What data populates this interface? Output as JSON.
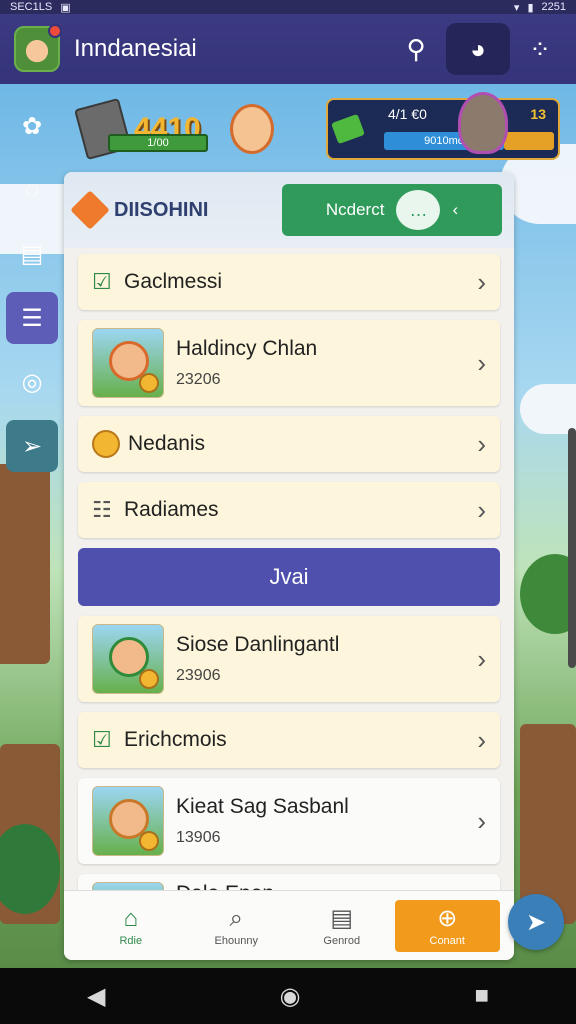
{
  "status_bar": {
    "left": "SEC1LS",
    "time": "2251"
  },
  "header": {
    "title": "Inndanesiai"
  },
  "banners": {
    "left": {
      "value": "4410",
      "bar_text": "1/00"
    },
    "right": {
      "top_text": "4/1 €0",
      "number": "13",
      "bar_text": "9010mo"
    }
  },
  "panel": {
    "title": "DIISOHINI",
    "header_button": "Ncderct",
    "rows": [
      {
        "kind": "cat",
        "label": "Gaclmessi",
        "icon": "☑"
      },
      {
        "kind": "game",
        "label": "Haldincy Chlan",
        "sub": "23206"
      },
      {
        "kind": "cat",
        "label": "Nedanis",
        "icon": "coin"
      },
      {
        "kind": "cat",
        "label": "Radiames",
        "icon": "☷"
      }
    ],
    "cta": "Jvai",
    "rows2": [
      {
        "kind": "game",
        "label": "Siose Danlingantl",
        "sub": "23906"
      },
      {
        "kind": "cat",
        "label": "Erichcmois",
        "icon": "☑"
      },
      {
        "kind": "game",
        "label": "Kieat Sag Sasbanl",
        "sub": "13906"
      },
      {
        "kind": "game",
        "label": "Dale Enen..",
        "sub": ""
      }
    ]
  },
  "bottom_nav": [
    {
      "label": "Rdie",
      "icon": "⌂"
    },
    {
      "label": "Ehounny",
      "icon": "⌕"
    },
    {
      "label": "Genrod",
      "icon": "▤"
    },
    {
      "label": "Conant",
      "icon": "⊕"
    }
  ]
}
